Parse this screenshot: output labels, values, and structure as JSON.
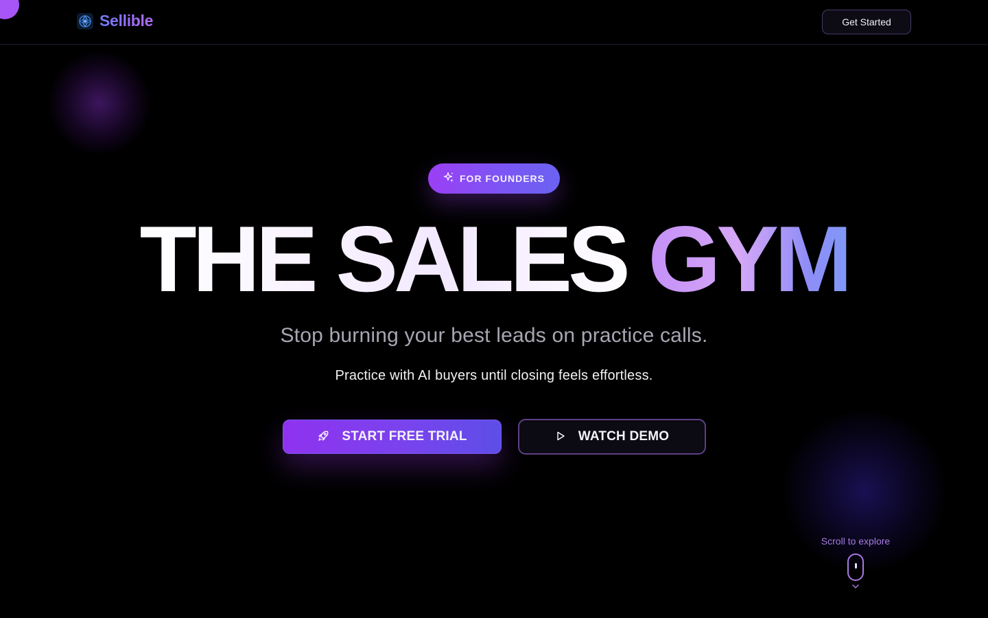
{
  "header": {
    "brand_name": "Sellible",
    "get_started_label": "Get Started"
  },
  "hero": {
    "badge_label": "FOR FOUNDERS",
    "headline_part1": "THE SALES ",
    "headline_part2": "GYM",
    "subheadline": "Stop burning your best leads on practice calls.",
    "tagline": "Practice with AI buyers until closing feels effortless.",
    "primary_cta_label": "START FREE TRIAL",
    "secondary_cta_label": "WATCH DEMO"
  },
  "scroll_hint": {
    "label": "Scroll to explore"
  },
  "icons": {
    "brand": "brand-logo-icon",
    "badge": "sparkles-icon",
    "primary_cta": "rocket-icon",
    "secondary_cta": "play-icon",
    "scroll": "mouse-icon",
    "scroll_arrow": "chevron-down-icon"
  },
  "colors": {
    "background": "#000000",
    "accent_purple": "#9b3ff5",
    "accent_indigo": "#5d4ee8",
    "muted_text": "#a9a6b3",
    "scroll_hint": "#a77be0"
  }
}
